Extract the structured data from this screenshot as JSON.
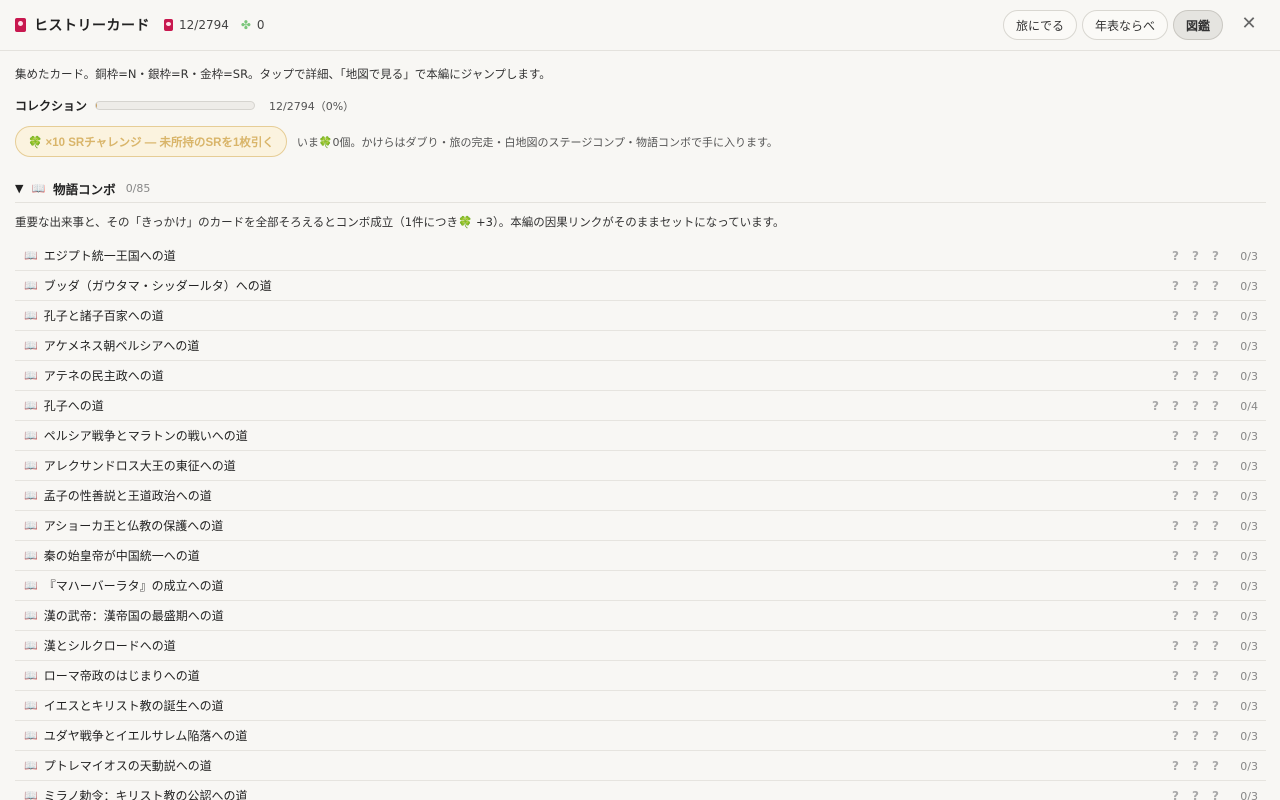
{
  "header": {
    "title": "ヒストリーカード",
    "card_count": "12/2794",
    "clover_count": "0",
    "buttons": [
      {
        "label": "旅にでる",
        "active": false
      },
      {
        "label": "年表ならべ",
        "active": false
      },
      {
        "label": "図鑑",
        "active": true
      }
    ],
    "close_icon": "close-icon"
  },
  "intro": "集めたカード。銅枠=N・銀枠=R・金枠=SR。タップで詳細、「地図で見る」で本編にジャンプします。",
  "collection": {
    "label": "コレクション",
    "progress_fraction": 0.0043,
    "text": "12/2794（0%）"
  },
  "sr_challenge": {
    "button_label": "🍀 ×10 SRチャレンジ — 未所持のSRを1枚引く",
    "note": "いま🍀0個。かけらはダブり・旅の完走・白地図のステージコンプ・物語コンボで手に入ります。"
  },
  "section": {
    "toggle": "▼",
    "title": "物語コンボ",
    "count": "0/85",
    "description": "重要な出来事と、その「きっかけ」のカードを全部そろえるとコンボ成立（1件につき🍀 +3）。本編の因果リンクがそのままセットになっています。"
  },
  "combos": [
    {
      "title": "エジプト統一王国への道",
      "slots": 3,
      "progress": "0/3"
    },
    {
      "title": "ブッダ（ガウタマ・シッダールタ）への道",
      "slots": 3,
      "progress": "0/3"
    },
    {
      "title": "孔子と諸子百家への道",
      "slots": 3,
      "progress": "0/3"
    },
    {
      "title": "アケメネス朝ペルシアへの道",
      "slots": 3,
      "progress": "0/3"
    },
    {
      "title": "アテネの民主政への道",
      "slots": 3,
      "progress": "0/3"
    },
    {
      "title": "孔子への道",
      "slots": 4,
      "progress": "0/4"
    },
    {
      "title": "ペルシア戦争とマラトンの戦いへの道",
      "slots": 3,
      "progress": "0/3"
    },
    {
      "title": "アレクサンドロス大王の東征への道",
      "slots": 3,
      "progress": "0/3"
    },
    {
      "title": "孟子の性善説と王道政治への道",
      "slots": 3,
      "progress": "0/3"
    },
    {
      "title": "アショーカ王と仏教の保護への道",
      "slots": 3,
      "progress": "0/3"
    },
    {
      "title": "秦の始皇帝が中国統一への道",
      "slots": 3,
      "progress": "0/3"
    },
    {
      "title": "『マハーバーラタ』の成立への道",
      "slots": 3,
      "progress": "0/3"
    },
    {
      "title": "漢の武帝：漢帝国の最盛期への道",
      "slots": 3,
      "progress": "0/3"
    },
    {
      "title": "漢とシルクロードへの道",
      "slots": 3,
      "progress": "0/3"
    },
    {
      "title": "ローマ帝政のはじまりへの道",
      "slots": 3,
      "progress": "0/3"
    },
    {
      "title": "イエスとキリスト教の誕生への道",
      "slots": 3,
      "progress": "0/3"
    },
    {
      "title": "ユダヤ戦争とイエルサレム陥落への道",
      "slots": 3,
      "progress": "0/3"
    },
    {
      "title": "プトレマイオスの天動説への道",
      "slots": 3,
      "progress": "0/3"
    },
    {
      "title": "ミラノ勅令：キリスト教の公認への道",
      "slots": 3,
      "progress": "0/3"
    }
  ],
  "unknown_mark": "?",
  "colors": {
    "accent_card": "#c8184f",
    "clover": "#7bc67b",
    "sr_gold": "#d9b56a"
  }
}
